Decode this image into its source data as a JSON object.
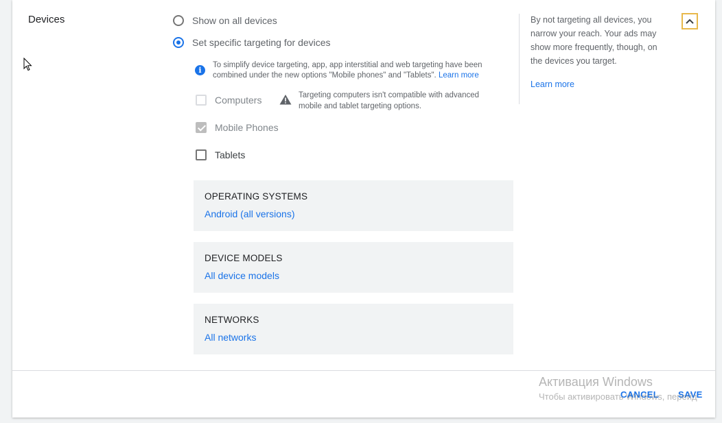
{
  "section": {
    "title": "Devices"
  },
  "radios": [
    {
      "label": "Show on all devices",
      "checked": false
    },
    {
      "label": "Set specific targeting for devices",
      "checked": true
    }
  ],
  "info": {
    "icon": "info-icon",
    "line1": "To simplify device targeting, app, app interstitial and web targeting have been",
    "line2": "combined under the new options \"Mobile phones\" and \"Tablets\".",
    "link": "Learn more"
  },
  "checkboxes": [
    {
      "label": "Computers",
      "state": "unchecked-disabled"
    },
    {
      "label": "Mobile Phones",
      "state": "checked-disabled"
    },
    {
      "label": "Tablets",
      "state": "unchecked"
    }
  ],
  "warning": {
    "icon": "warning-icon",
    "line1": "Targeting computers isn't compatible with advanced",
    "line2": "mobile and tablet targeting options."
  },
  "panels": [
    {
      "title": "OPERATING SYSTEMS",
      "value": "Android (all versions)"
    },
    {
      "title": "DEVICE MODELS",
      "value": "All device models"
    },
    {
      "title": "NETWORKS",
      "value": "All networks"
    }
  ],
  "sidebar": {
    "text": "By not targeting all devices, you narrow your reach. Your ads may show more frequently, though, on the devices you target.",
    "link": "Learn more"
  },
  "actions": {
    "cancel": "CANCEL",
    "save": "SAVE"
  },
  "watermark": {
    "title": "Активация Windows",
    "subtitle": "Чтобы активировать Windows, перейд"
  },
  "colors": {
    "accent": "#1a73e8",
    "panel_bg": "#f1f3f4",
    "focus_outline": "#e8b84a"
  }
}
